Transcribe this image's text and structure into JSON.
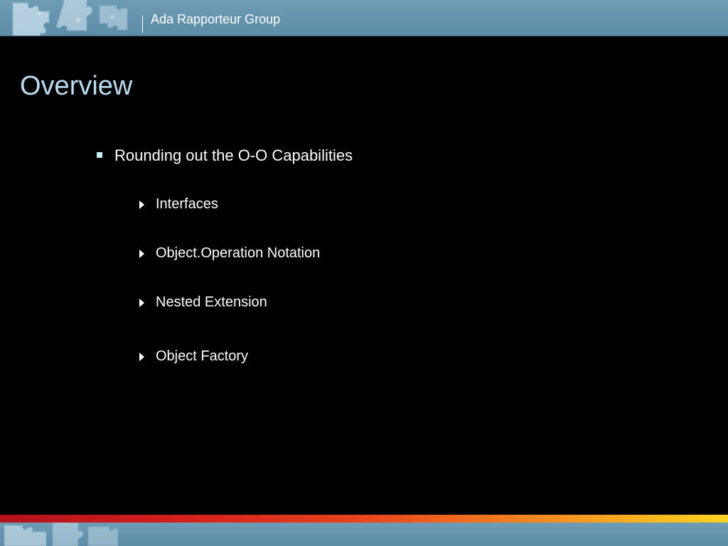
{
  "header": {
    "title": "Ada Rapporteur Group"
  },
  "slide": {
    "title": "Overview",
    "bullet": "Rounding out the O-O Capabilities",
    "subbullets": [
      "Interfaces",
      "Object.Operation Notation",
      "Nested Extension",
      "Object Factory"
    ]
  },
  "colors": {
    "background": "#000000",
    "band": "#6f9cb5",
    "title": "#b9dcf2",
    "bullet_square": "#c7ecf6"
  }
}
